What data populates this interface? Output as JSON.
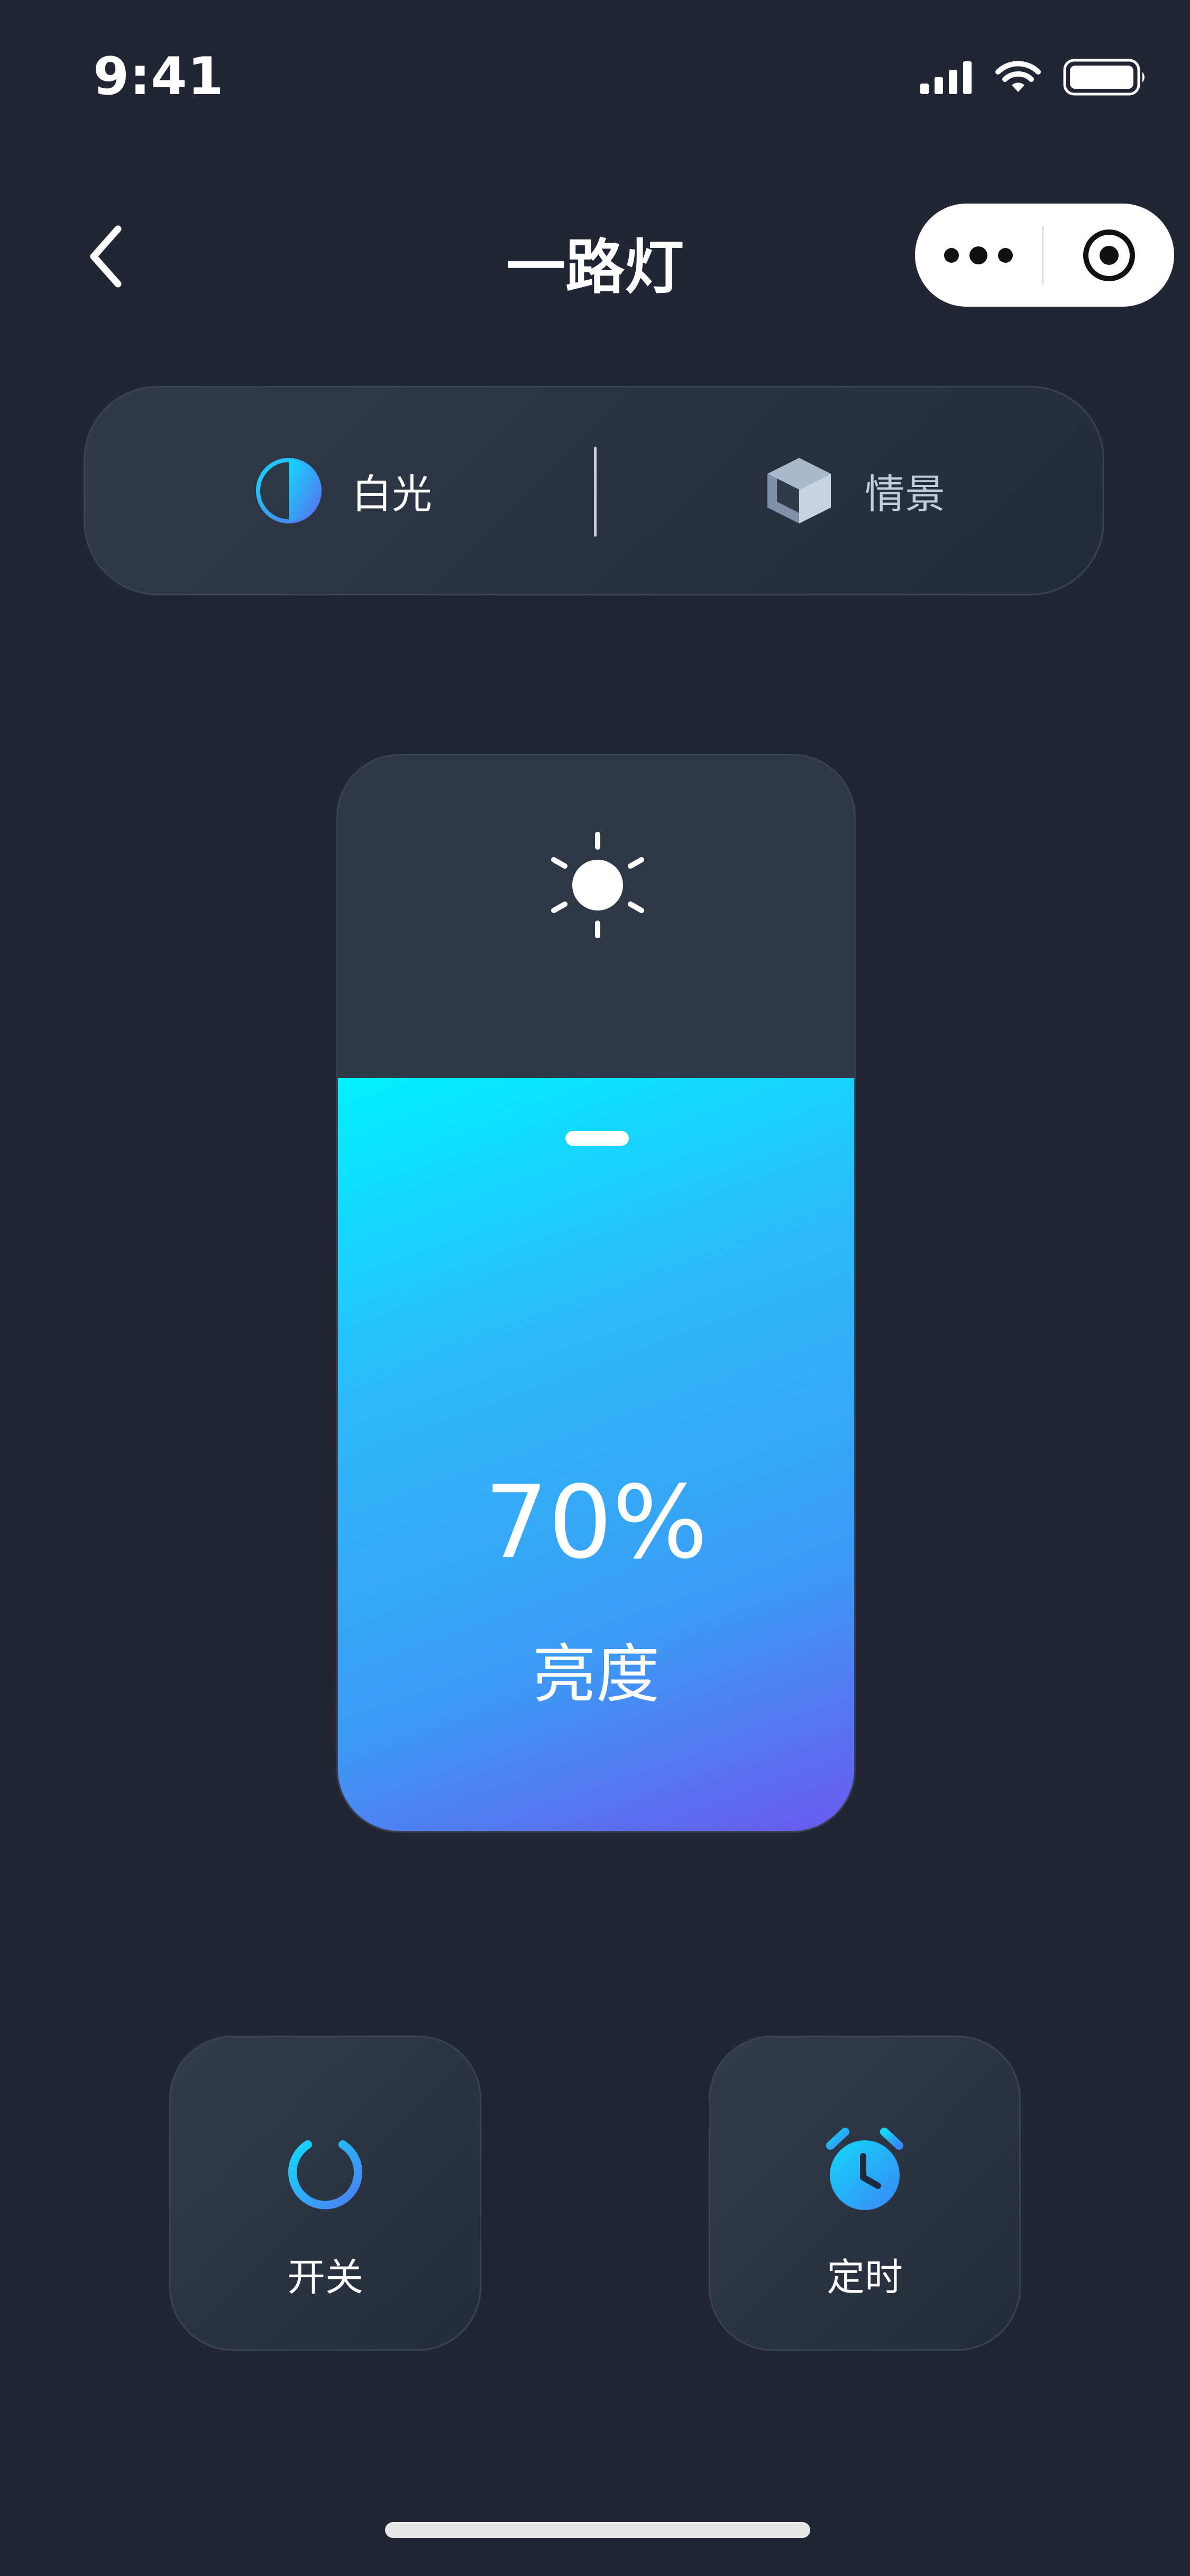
{
  "status_bar": {
    "time": "9:41"
  },
  "nav": {
    "title": "一路灯"
  },
  "mode_tabs": [
    {
      "label": "白光",
      "icon": "half-circle-icon",
      "active": true
    },
    {
      "label": "情景",
      "icon": "cube-icon",
      "active": false
    }
  ],
  "brightness": {
    "value_text": "70%",
    "label": "亮度",
    "level": 0.7
  },
  "actions": [
    {
      "label": "开关",
      "icon": "power-icon"
    },
    {
      "label": "定时",
      "icon": "alarm-clock-icon"
    }
  ],
  "colors": {
    "background": "#222634",
    "accent_start": "#00f2ff",
    "accent_end": "#6a59ef"
  }
}
